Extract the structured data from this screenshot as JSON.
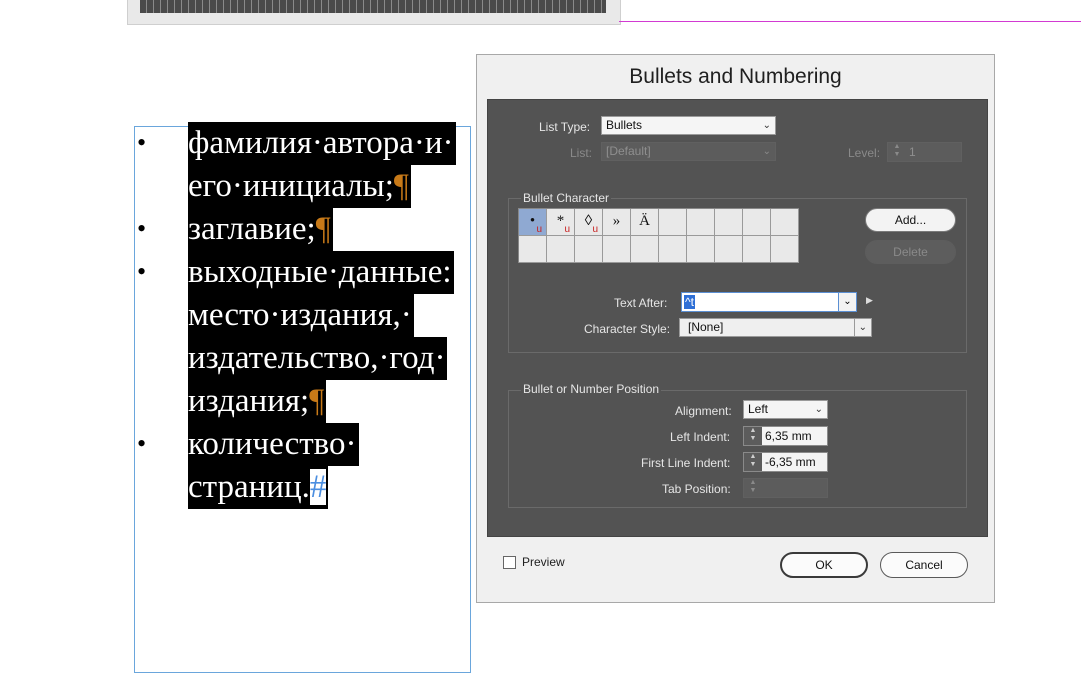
{
  "document": {
    "lines": [
      "фамилия·автора·и·",
      "его·инициалы;",
      "заглавие;",
      "выходные·данные:",
      "место·издания,·",
      "издательство,·год·",
      "издания;",
      "количество·",
      "страниц."
    ],
    "bullet_char": "•",
    "pilcrow": "¶",
    "end_mark": "#"
  },
  "dialog": {
    "title": "Bullets and Numbering",
    "list_type_label": "List Type:",
    "list_type_value": "Bullets",
    "list_label": "List:",
    "list_value": "[Default]",
    "level_label": "Level:",
    "level_value": "1",
    "bullet_character_title": "Bullet Character",
    "bullet_glyphs": [
      "•",
      "*",
      "◊",
      "»",
      "Ä"
    ],
    "bullet_glyph_flags": [
      "u",
      "u",
      "u",
      "",
      ""
    ],
    "add_label": "Add...",
    "delete_label": "Delete",
    "text_after_label": "Text After:",
    "text_after_value": "^t",
    "character_style_label": "Character Style:",
    "character_style_value": "[None]",
    "position_title": "Bullet or Number Position",
    "alignment_label": "Alignment:",
    "alignment_value": "Left",
    "left_indent_label": "Left Indent:",
    "left_indent_value": "6,35 mm",
    "first_line_indent_label": "First Line Indent:",
    "first_line_indent_value": "-6,35 mm",
    "tab_position_label": "Tab Position:",
    "tab_position_value": "",
    "preview_label": "Preview",
    "preview_checked": false,
    "ok_label": "OK",
    "cancel_label": "Cancel"
  },
  "colors": {
    "selection_bg": "#000000",
    "selected_text": "#ffffff",
    "pilcrow": "#c87a18",
    "end_mark": "#4b8ee0",
    "dialog_body": "#535353",
    "guide": "#d23ad2"
  }
}
